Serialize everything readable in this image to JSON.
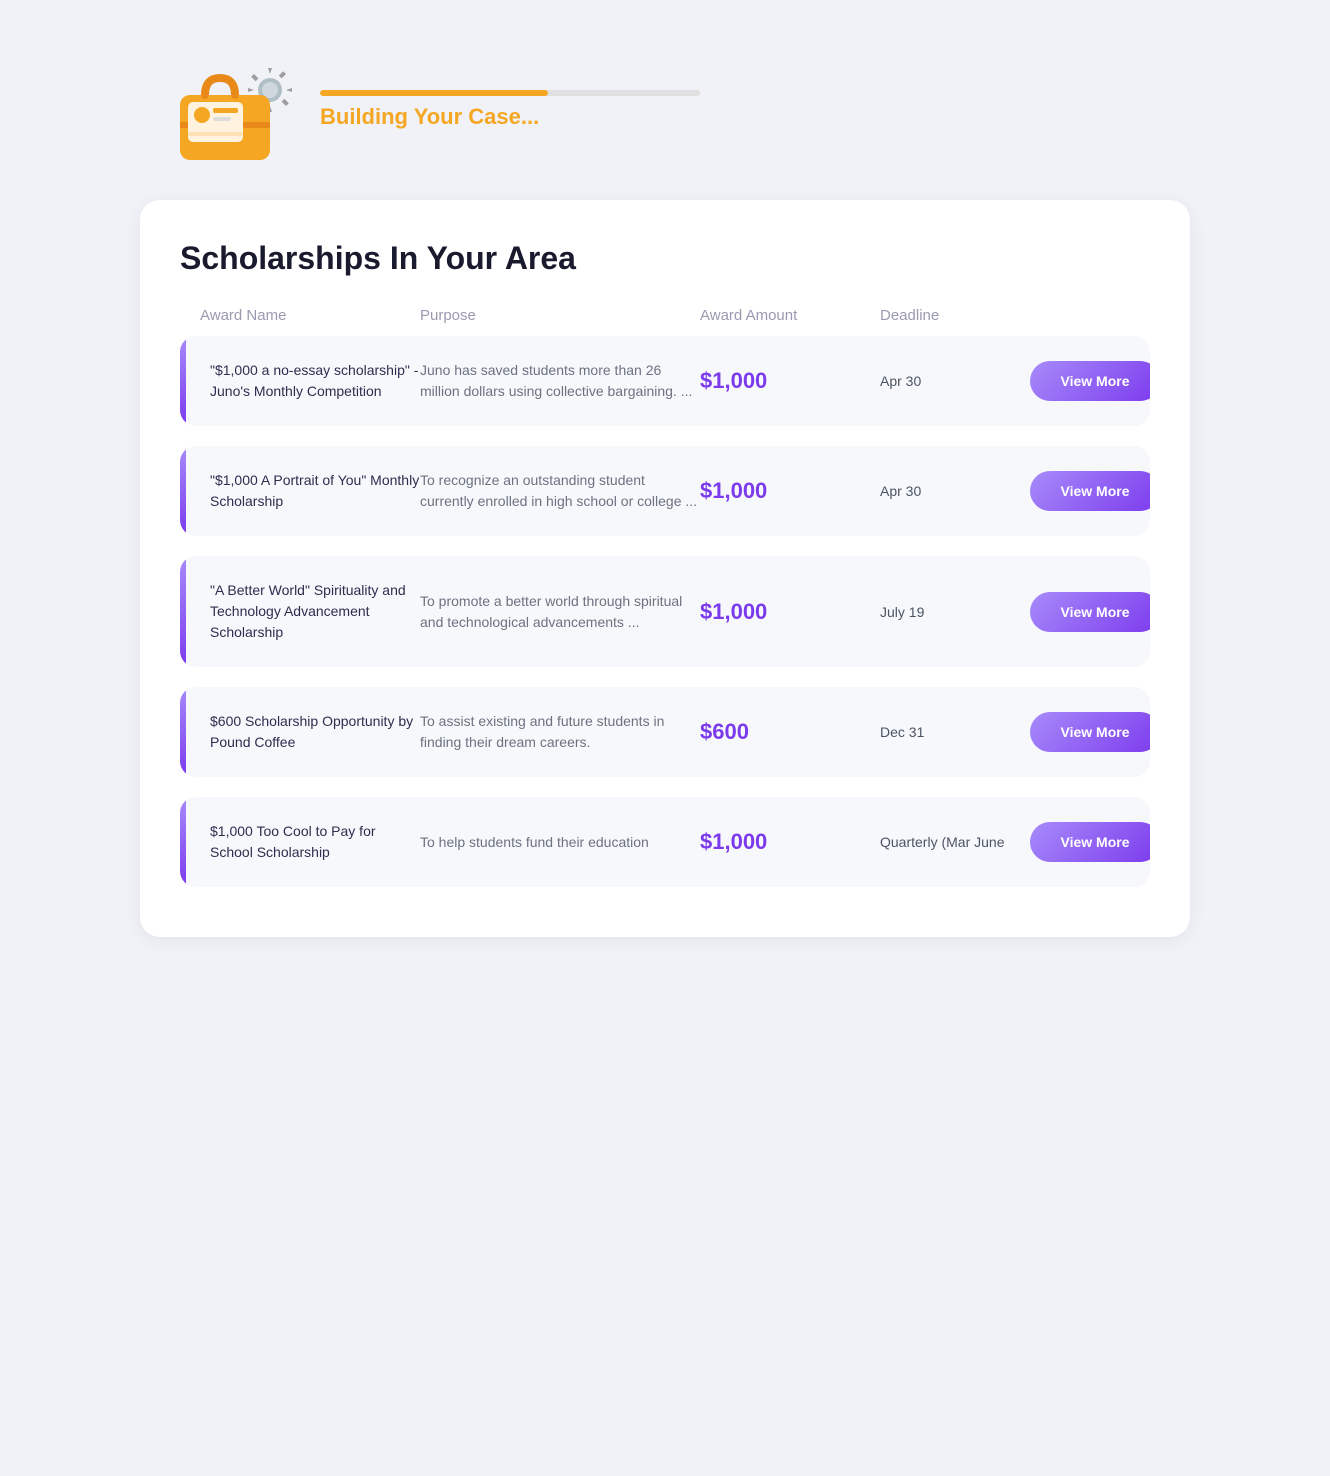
{
  "header": {
    "progress_label": "Building Your Case...",
    "progress_percent": 60
  },
  "section": {
    "title": "Scholarships In Your Area"
  },
  "table_headers": {
    "col1": "Award Name",
    "col2": "Purpose",
    "col3": "Award Amount",
    "col4": "Deadline",
    "col5": ""
  },
  "scholarships": [
    {
      "id": 1,
      "name": "\"$1,000 a no-essay scholarship\" - Juno's Monthly Competition",
      "purpose": "Juno has saved students more than 26 million dollars using collective bargaining. ...",
      "amount": "$1,000",
      "deadline": "Apr 30",
      "button_label": "View More"
    },
    {
      "id": 2,
      "name": "\"$1,000 A Portrait of You\" Monthly Scholarship",
      "purpose": "To recognize an outstanding student currently enrolled in high school or college ...",
      "amount": "$1,000",
      "deadline": "Apr 30",
      "button_label": "View More"
    },
    {
      "id": 3,
      "name": "\"A Better World\" Spirituality and Technology Advancement Scholarship",
      "purpose": "To promote a better world through spiritual and technological advancements ...",
      "amount": "$1,000",
      "deadline": "July 19",
      "button_label": "View More"
    },
    {
      "id": 4,
      "name": "$600 Scholarship Opportunity by Pound Coffee",
      "purpose": "To assist existing and future students in finding their dream careers.",
      "amount": "$600",
      "deadline": "Dec 31",
      "button_label": "View More"
    },
    {
      "id": 5,
      "name": "$1,000 Too Cool to Pay for School Scholarship",
      "purpose": "To help students fund their education",
      "amount": "$1,000",
      "deadline": "Quarterly (Mar June",
      "button_label": "View More"
    }
  ]
}
